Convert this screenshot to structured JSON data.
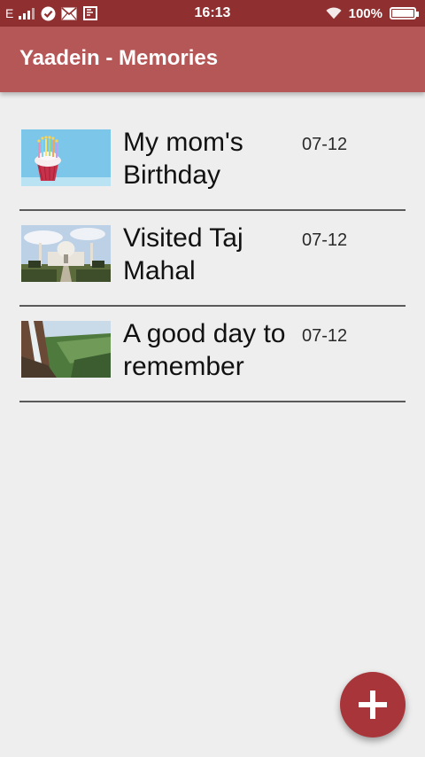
{
  "status_bar": {
    "network_type": "E",
    "time": "16:13",
    "battery_text": "100%",
    "battery_level": 1.0
  },
  "app_bar": {
    "title": "Yaadein - Memories"
  },
  "memories": [
    {
      "title": "My mom's Birthday",
      "date": "07-12",
      "thumbnail": "birthday-cupcake"
    },
    {
      "title": "Visited Taj Mahal",
      "date": "07-12",
      "thumbnail": "taj-mahal"
    },
    {
      "title": "A good day to remember",
      "date": "07-12",
      "thumbnail": "waterfall-valley"
    }
  ],
  "fab": {
    "icon": "plus-icon"
  },
  "colors": {
    "status_bar": "#8f2f30",
    "app_bar": "#b55657",
    "fab": "#a8353a",
    "background": "#eeeeee"
  }
}
